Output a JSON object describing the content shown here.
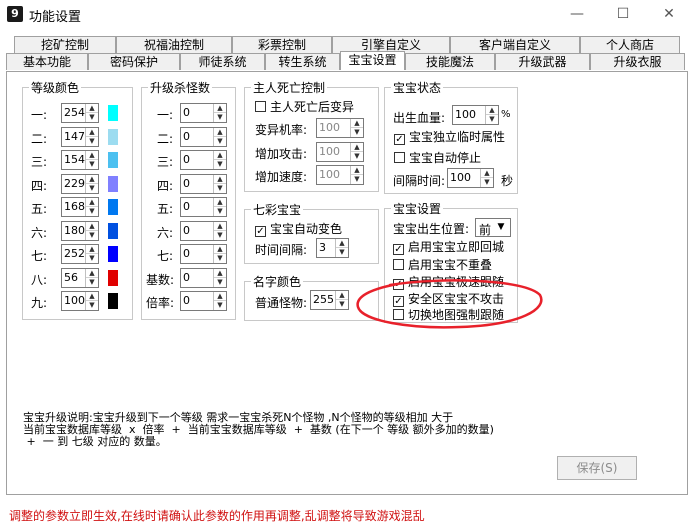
{
  "window": {
    "title": "功能设置",
    "app_icon": "9"
  },
  "tabs_row1": [
    "挖矿控制",
    "祝福油控制",
    "彩票控制",
    "引擎自定义",
    "客户端自定义",
    "个人商店"
  ],
  "tabs_row2": [
    "基本功能",
    "密码保护",
    "师徒系统",
    "转生系统",
    "宝宝设置",
    "技能魔法",
    "升级武器",
    "升级衣服"
  ],
  "active_tab": "宝宝设置",
  "level_colors": {
    "title": "等级颜色",
    "rows": [
      {
        "label": "一:",
        "value": "254",
        "color": "#00ffff"
      },
      {
        "label": "二:",
        "value": "147",
        "color": "#9cdcf0"
      },
      {
        "label": "三:",
        "value": "154",
        "color": "#4cc0f0"
      },
      {
        "label": "四:",
        "value": "229",
        "color": "#8080ff"
      },
      {
        "label": "五:",
        "value": "168",
        "color": "#0078f0"
      },
      {
        "label": "六:",
        "value": "180",
        "color": "#0050e0"
      },
      {
        "label": "七:",
        "value": "252",
        "color": "#0000ff"
      },
      {
        "label": "八:",
        "value": "56",
        "color": "#e00000"
      },
      {
        "label": "九:",
        "value": "100",
        "color": "#000000"
      }
    ]
  },
  "kill_count": {
    "title": "升级杀怪数",
    "rows": [
      {
        "label": "一:",
        "value": "0"
      },
      {
        "label": "二:",
        "value": "0"
      },
      {
        "label": "三:",
        "value": "0"
      },
      {
        "label": "四:",
        "value": "0"
      },
      {
        "label": "五:",
        "value": "0"
      },
      {
        "label": "六:",
        "value": "0"
      },
      {
        "label": "七:",
        "value": "0"
      },
      {
        "label": "基数:",
        "value": "0"
      },
      {
        "label": "倍率:",
        "value": "0"
      }
    ]
  },
  "owner_death": {
    "title": "主人死亡控制",
    "mutate_label": "主人死亡后变异",
    "rows": [
      {
        "label": "变异机率:",
        "value": "100"
      },
      {
        "label": "增加攻击:",
        "value": "100"
      },
      {
        "label": "增加速度:",
        "value": "100"
      }
    ]
  },
  "rainbow": {
    "title": "七彩宝宝",
    "auto_color_label": "宝宝自动变色",
    "interval_label": "时间间隔:",
    "interval_value": "3"
  },
  "name_color": {
    "title": "名字颜色",
    "label": "普通怪物:",
    "value": "255"
  },
  "baby_status": {
    "title": "宝宝状态",
    "hp_label": "出生血量:",
    "hp_value": "100",
    "hp_unit": "%",
    "independent_label": "宝宝独立临时属性",
    "auto_stop_label": "宝宝自动停止",
    "interval_label": "间隔时间:",
    "interval_value": "100",
    "interval_unit": "秒"
  },
  "baby_settings": {
    "title": "宝宝设置",
    "spawn_label": "宝宝出生位置:",
    "spawn_value": "前",
    "options": [
      {
        "label": "启用宝宝立即回城",
        "checked": true
      },
      {
        "label": "启用宝宝不重叠",
        "checked": false
      },
      {
        "label": "启用宝宝极速跟随",
        "checked": true
      },
      {
        "label": "安全区宝宝不攻击",
        "checked": true
      },
      {
        "label": "切换地图强制跟随",
        "checked": false
      }
    ]
  },
  "description": "宝宝升级说明:宝宝升级到下一个等级 需求一宝宝杀死N个怪物 ,N个怪物的等级相加 大于\n当前宝宝数据库等级  x  倍率  +  当前宝宝数据库等级  +  基数 (在下一个 等级 额外多加的数量)\n +  一 到 七级 对应的 数量。",
  "save_button": "保存(S)",
  "warning": "调整的参数立即生效,在线时请确认此参数的作用再调整,乱调整将导致游戏混乱",
  "colors": {
    "annotation": "#e8212b",
    "warning": "#d01010"
  }
}
